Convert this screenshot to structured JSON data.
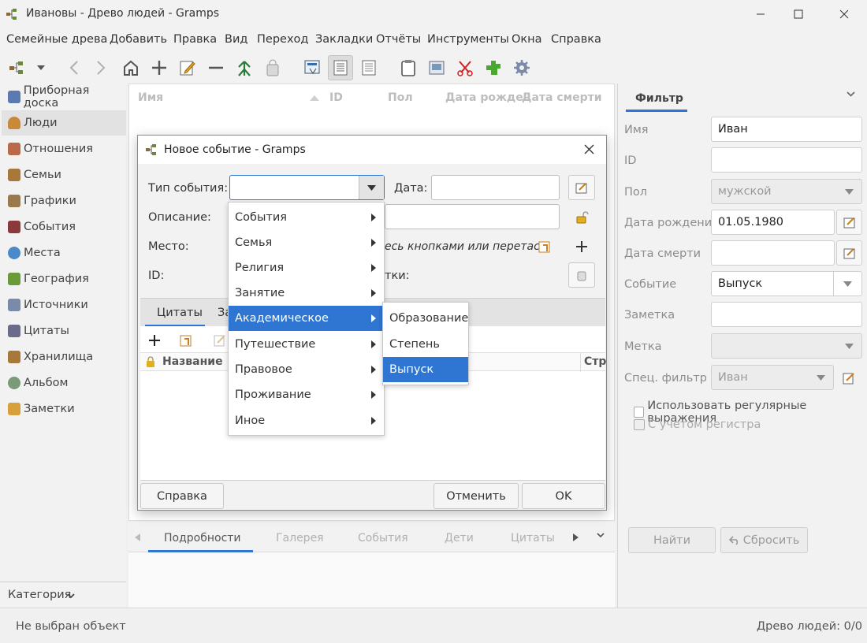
{
  "window": {
    "title": "Ивановы - Древо людей - Gramps"
  },
  "menubar": [
    "Семейные древа",
    "Добавить",
    "Правка",
    "Вид",
    "Переход",
    "Закладки",
    "Отчёты",
    "Инструменты",
    "Окна",
    "Справка"
  ],
  "sidebar": {
    "items": [
      "Приборная доска",
      "Люди",
      "Отношения",
      "Семьи",
      "Графики",
      "События",
      "Места",
      "География",
      "Источники",
      "Цитаты",
      "Хранилища",
      "Альбом",
      "Заметки"
    ],
    "selected": "Люди",
    "category_label": "Категория"
  },
  "people_list": {
    "columns": [
      "Имя",
      "ID",
      "Пол",
      "Дата рожден",
      "Дата смерти"
    ]
  },
  "bottom_tabs": [
    "Подробности",
    "Галерея",
    "События",
    "Дети",
    "Цитаты"
  ],
  "filter": {
    "tab": "Фильтр",
    "fields": [
      {
        "label": "Имя",
        "value": "Иван"
      },
      {
        "label": "ID",
        "value": ""
      },
      {
        "label": "Пол",
        "value": "мужской"
      },
      {
        "label": "Дата рождения",
        "value": "01.05.1980"
      },
      {
        "label": "Дата смерти",
        "value": ""
      },
      {
        "label": "Событие",
        "value": "Выпуск"
      },
      {
        "label": "Заметка",
        "value": ""
      },
      {
        "label": "Метка",
        "value": ""
      },
      {
        "label": "Спец. фильтр",
        "value": "Иван"
      }
    ],
    "use_regex": "Использовать регулярные выражения",
    "case_sensitive": "С учетом регистра",
    "find_button": "Найти",
    "reset_button": "Сбросить"
  },
  "status": {
    "left": "Не выбран объект",
    "right": "Древо людей: 0/0"
  },
  "dialog": {
    "title": "Новое событие - Gramps",
    "event_type_label": "Тип события:",
    "date_label": "Дата:",
    "description_label": "Описание:",
    "place_label": "Место:",
    "place_hint_partial": "есь кнопками или перетас...",
    "id_label": "ID:",
    "tags_label_partial": "тки:",
    "tabs": [
      "Цитаты",
      "За"
    ],
    "citation_col_title": "Название",
    "citation_col_right": "Стр",
    "help_button": "Справка",
    "cancel_button": "Отменить",
    "ok_button": "OK"
  },
  "event_type_menu": {
    "items": [
      "События",
      "Семья",
      "Религия",
      "Занятие",
      "Академическое",
      "Путешествие",
      "Правовое",
      "Проживание",
      "Иное"
    ],
    "highlighted": "Академическое"
  },
  "academic_submenu": {
    "items": [
      "Образование",
      "Степень",
      "Выпуск"
    ],
    "highlighted": "Выпуск"
  },
  "colors": {
    "accent": "#2f76d2",
    "tab_underline": "#2f76d2"
  }
}
